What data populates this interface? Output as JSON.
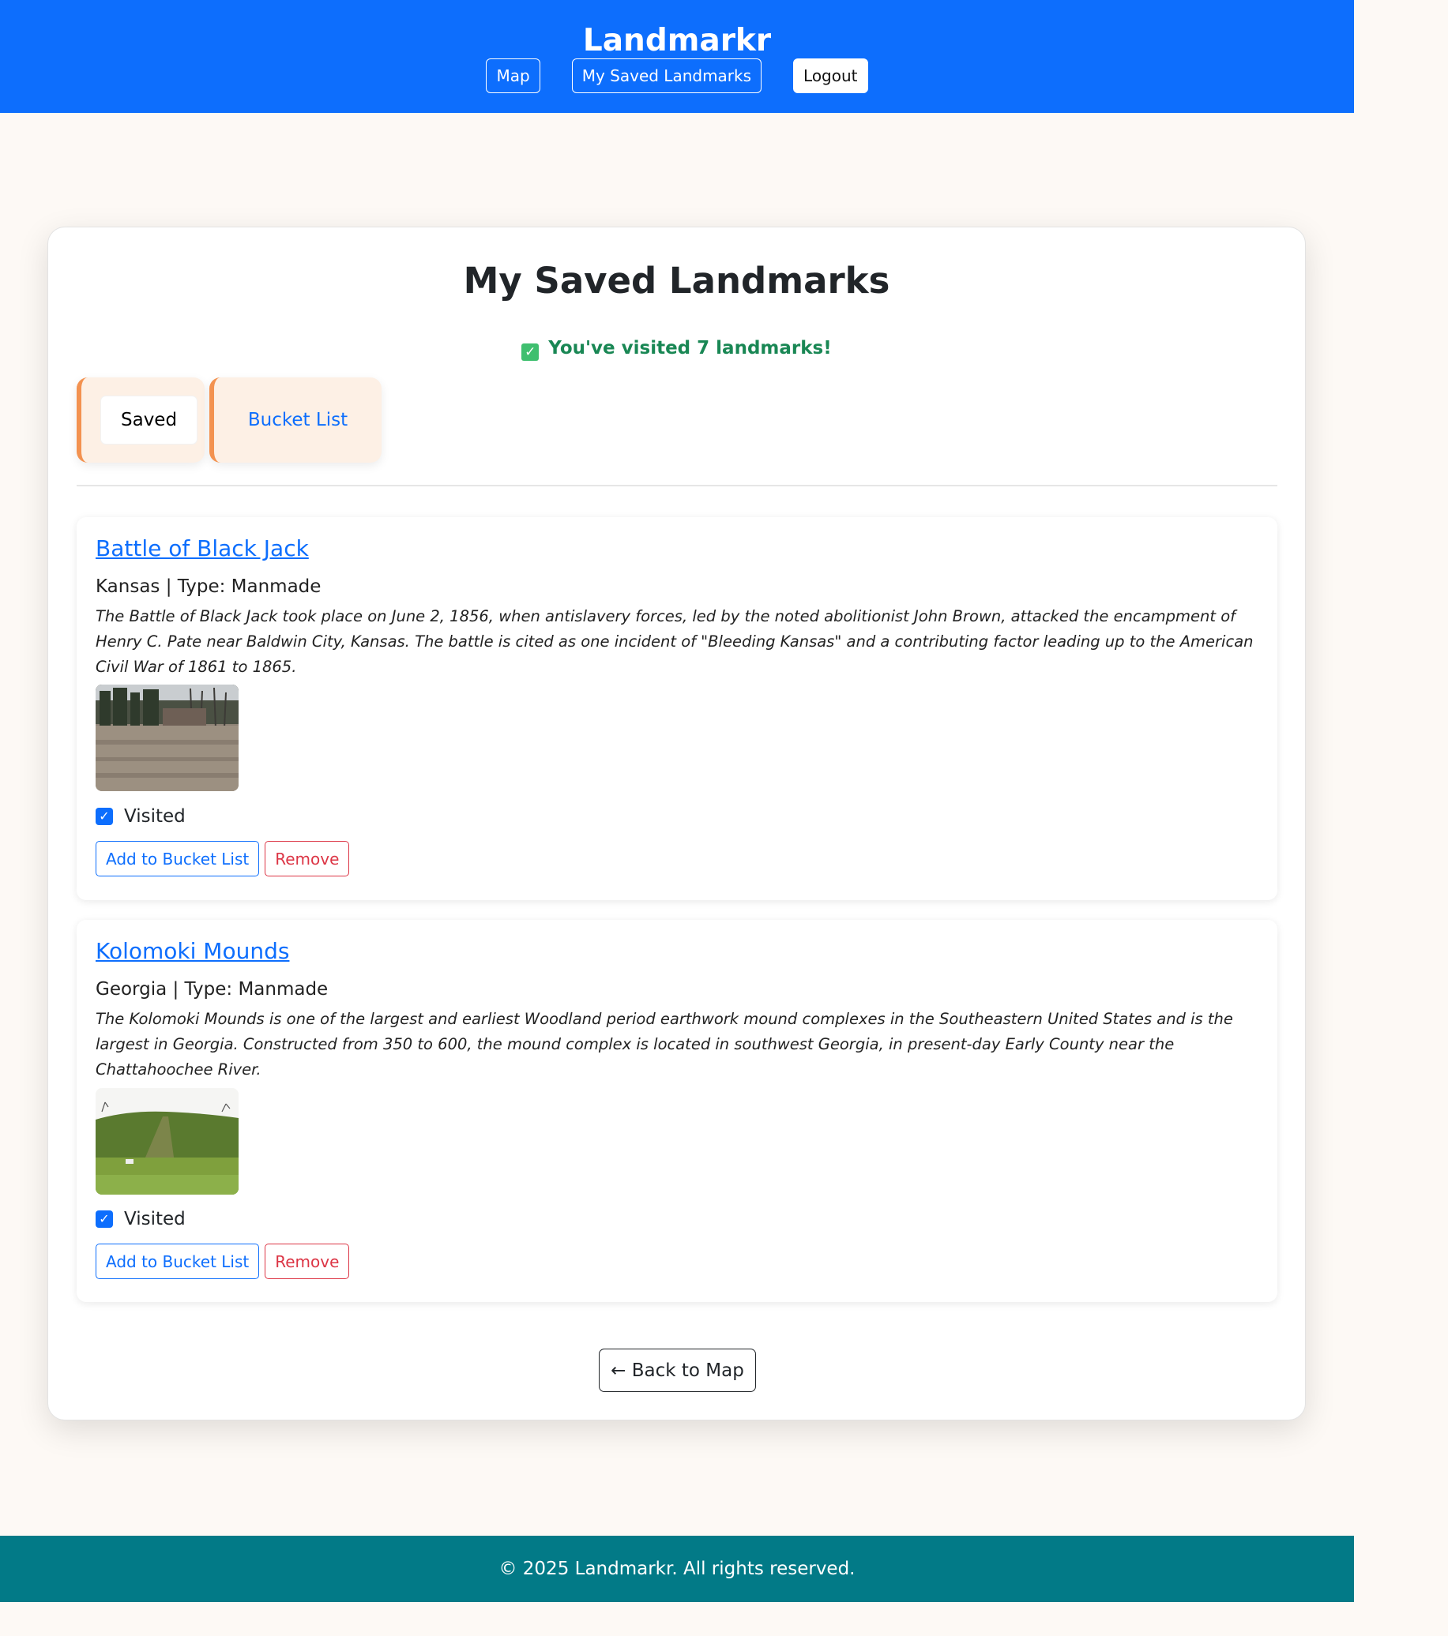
{
  "header": {
    "brand": "Landmarkr",
    "nav": {
      "map": "Map",
      "saved": "My Saved Landmarks",
      "logout": "Logout"
    }
  },
  "main": {
    "title": "My Saved Landmarks",
    "visited_icon": "✓",
    "visited_summary": "You've visited 7 landmarks!",
    "tabs": {
      "saved": "Saved",
      "bucket": "Bucket List"
    },
    "landmarks": [
      {
        "name": "Battle of Black Jack",
        "meta": "Kansas | Type: Manmade",
        "description": "The Battle of Black Jack took place on June 2, 1856, when antislavery forces, led by the noted abolitionist John Brown, attacked the encampment of Henry C. Pate near Baldwin City, Kansas. The battle is cited as one incident of \"Bleeding Kansas\" and a contributing factor leading up to the American Civil War of 1861 to 1865.",
        "visited_label": "Visited",
        "visited": true,
        "add_bucket": "Add to Bucket List",
        "remove": "Remove"
      },
      {
        "name": "Kolomoki Mounds",
        "meta": "Georgia | Type: Manmade",
        "description": "The Kolomoki Mounds is one of the largest and earliest Woodland period earthwork mound complexes in the Southeastern United States and is the largest in Georgia. Constructed from 350 to 600, the mound complex is located in southwest Georgia, in present-day Early County near the Chattahoochee River.",
        "visited_label": "Visited",
        "visited": true,
        "add_bucket": "Add to Bucket List",
        "remove": "Remove"
      }
    ],
    "back_button": "← Back to Map"
  },
  "footer": {
    "text": "© 2025 Landmarkr. All rights reserved."
  },
  "colors": {
    "primary": "#0d6efd",
    "footer": "#027a87",
    "accent": "#f39250",
    "success": "#198754",
    "danger": "#dc3545"
  }
}
